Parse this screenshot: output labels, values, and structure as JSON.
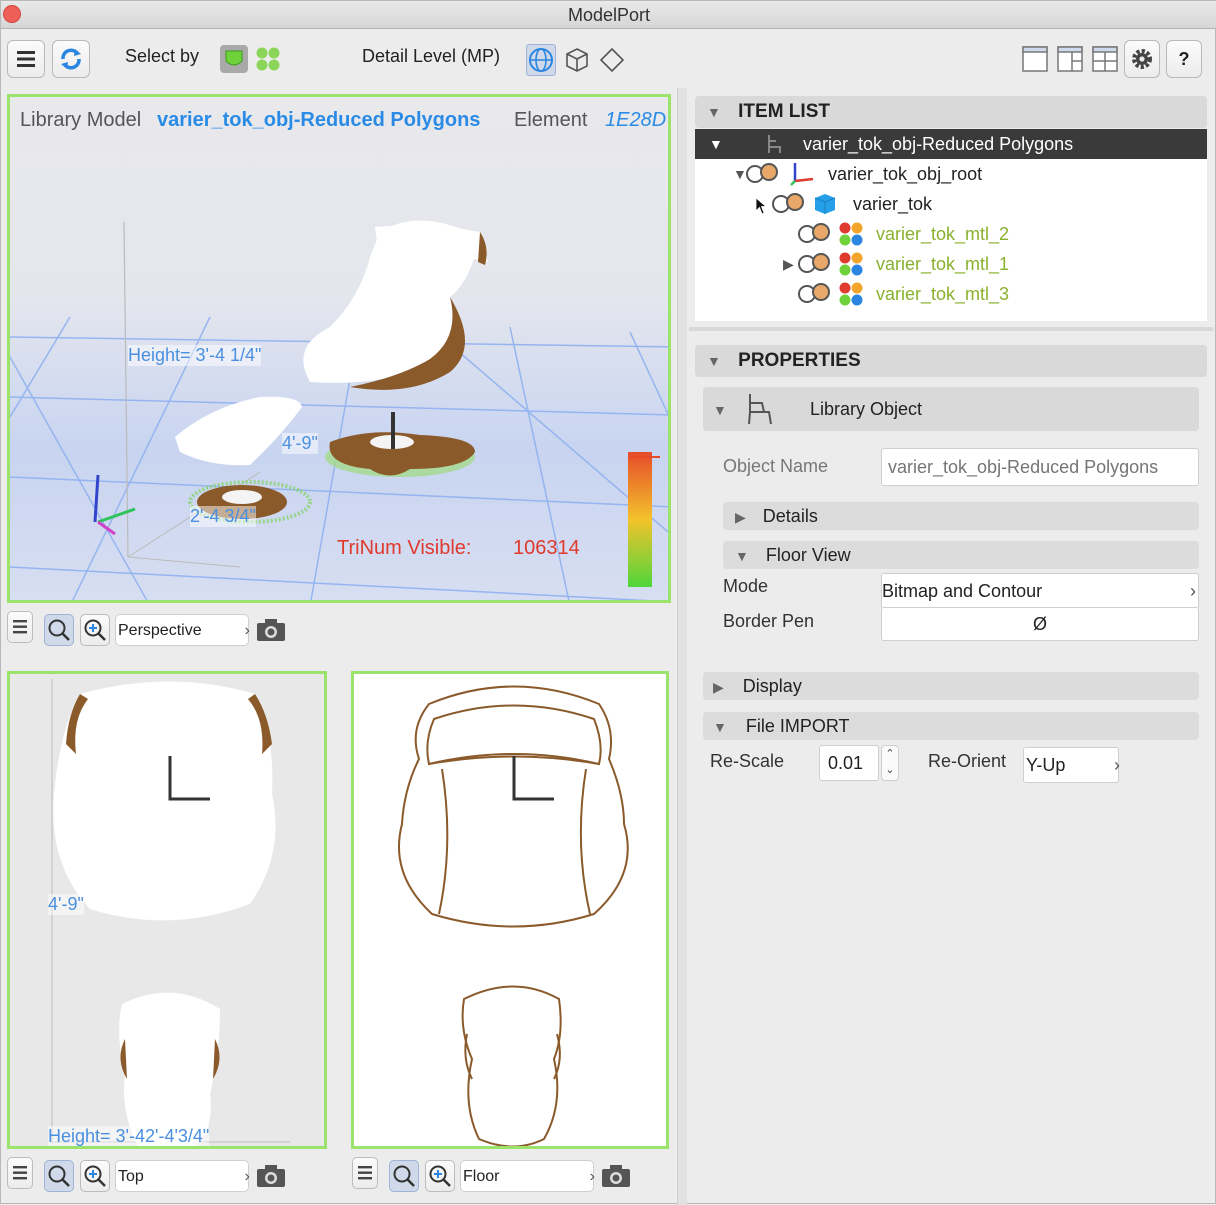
{
  "window": {
    "title": "ModelPort"
  },
  "toolbar": {
    "select_by_label": "Select by",
    "detail_level_label": "Detail Level (MP)",
    "help_label": "?"
  },
  "view3d": {
    "library_model_label": "Library Model",
    "library_model_value": "varier_tok_obj-Reduced Polygons",
    "element_label": "Element",
    "element_value": "1E28D",
    "height_dim": "Height= 3'-4 1/4\"",
    "width_dim": "4'-9\"",
    "depth_dim": "2'-4 3/4\"",
    "trinum_label": "TriNum Visible:",
    "trinum_value": "106314",
    "mode": "Perspective"
  },
  "viewTop": {
    "mode": "Top",
    "width_dim": "4'-9\"",
    "height_dim": "Height= 3'-42'-4'3/4\""
  },
  "viewFloor": {
    "mode": "Floor"
  },
  "item_list": {
    "title": "ITEM LIST",
    "items": [
      {
        "label": "varier_tok_obj-Reduced Polygons"
      },
      {
        "label": "varier_tok_obj_root"
      },
      {
        "label": "varier_tok"
      },
      {
        "label": "varier_tok_mtl_2"
      },
      {
        "label": "varier_tok_mtl_1"
      },
      {
        "label": "varier_tok_mtl_3"
      }
    ]
  },
  "properties": {
    "title": "PROPERTIES",
    "library_object_label": "Library Object",
    "object_name_label": "Object Name",
    "object_name_placeholder": "varier_tok_obj-Reduced Polygons",
    "details_label": "Details",
    "floor_view_label": "Floor View",
    "mode_label": "Mode",
    "mode_value": "Bitmap and Contour",
    "border_pen_label": "Border Pen",
    "border_pen_value": "Ø",
    "display_label": "Display",
    "file_import_label": "File IMPORT",
    "rescale_label": "Re-Scale",
    "rescale_value": "0.01",
    "reorient_label": "Re-Orient",
    "reorient_value": "Y-Up"
  },
  "colors": {
    "accent_green": "#9be36b",
    "link_blue": "#2a8be6",
    "material_green": "#8ab12e",
    "warn_red": "#e0392d"
  }
}
